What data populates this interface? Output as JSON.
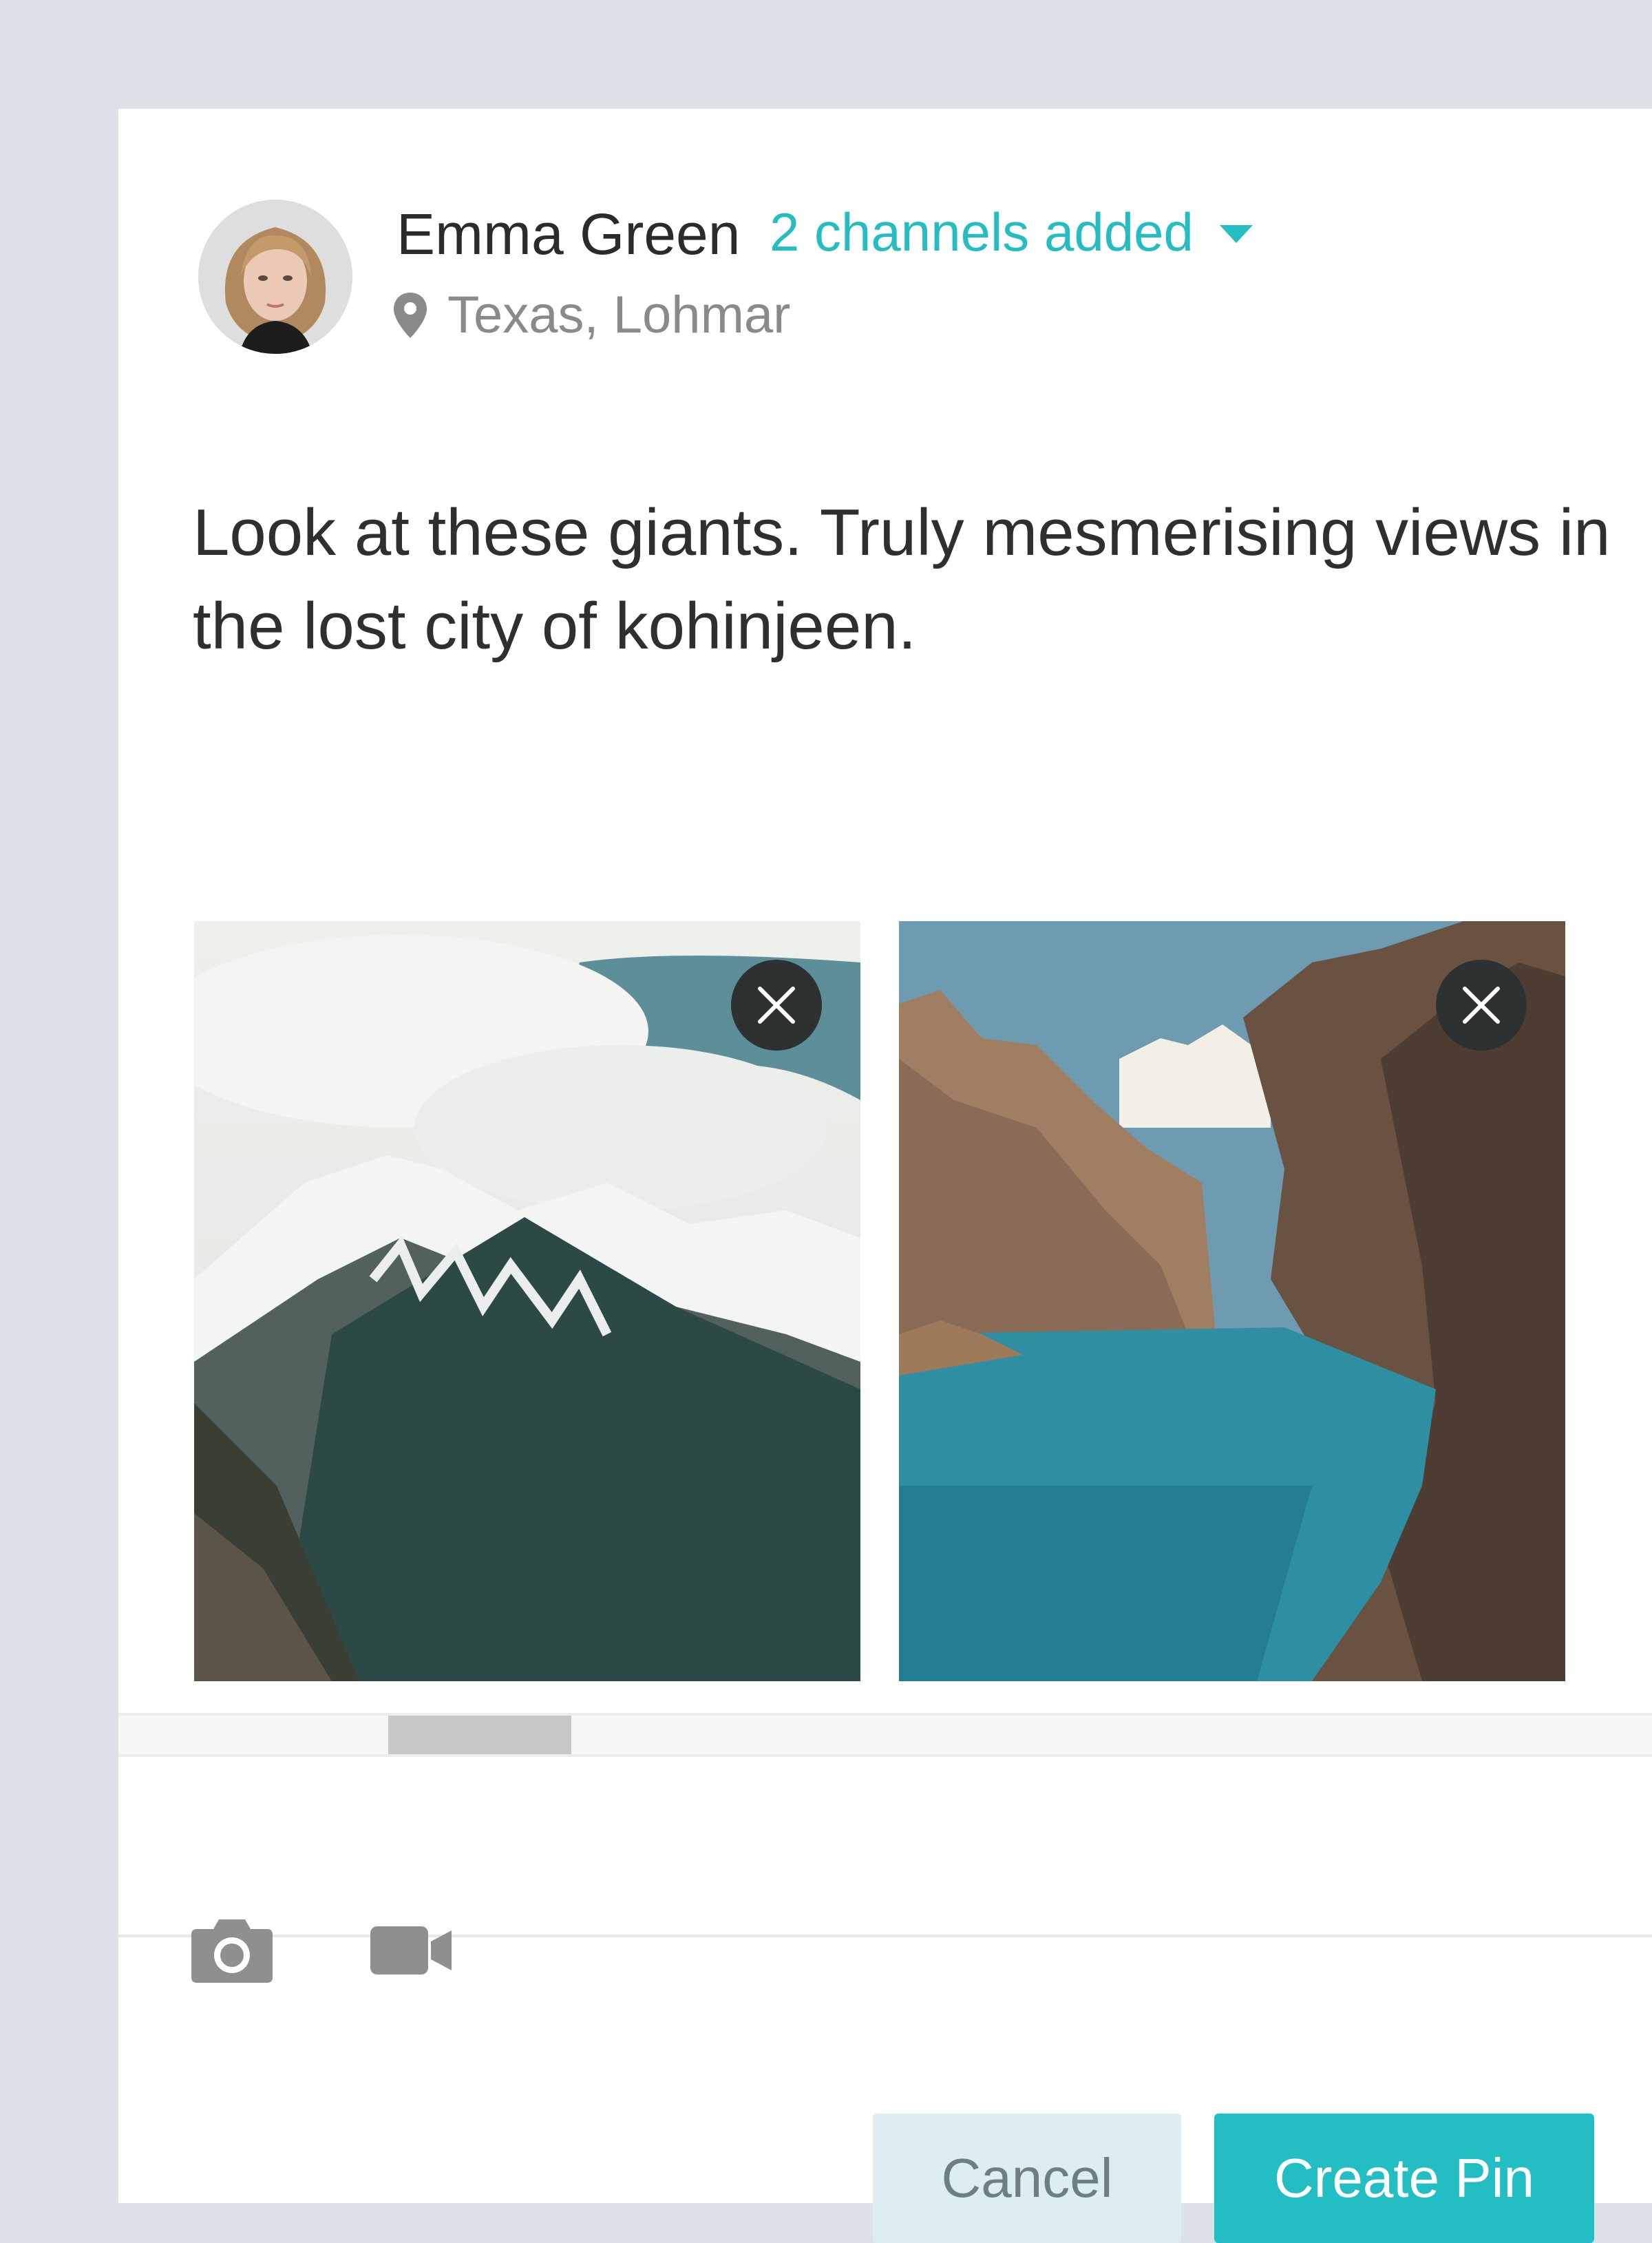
{
  "post": {
    "user_name": "Emma Green",
    "channels_label": "2 channels added",
    "location": "Texas, Lohmar",
    "text": "Look at these giants. Truly mesmerising views in the lost city of kohinjeen."
  },
  "actions": {
    "cancel_label": "Cancel",
    "create_label": "Create Pin"
  },
  "colors": {
    "accent": "#22bec4",
    "cancel_bg": "#deedf0",
    "background": "#dde1e8"
  },
  "icons": [
    "location-pin-icon",
    "chevron-down-icon",
    "close-icon",
    "camera-icon",
    "video-camera-icon"
  ]
}
